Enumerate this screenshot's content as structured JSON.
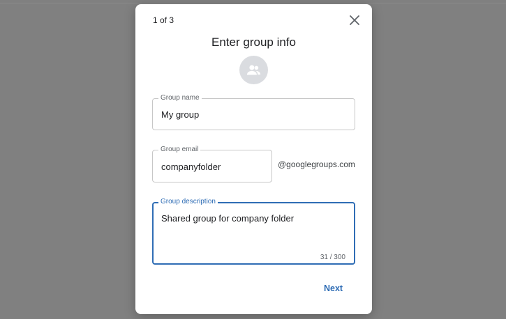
{
  "dialog": {
    "step": "1 of 3",
    "title": "Enter group info",
    "close_icon": "close-icon",
    "avatar_icon": "group-icon",
    "next_label": "Next"
  },
  "form": {
    "group_name": {
      "label": "Group name",
      "value": "My group"
    },
    "group_email": {
      "label": "Group email",
      "value": "companyfolder",
      "suffix": "@googlegroups.com"
    },
    "group_description": {
      "label": "Group description",
      "value": "Shared group for company folder",
      "counter": "31 / 300"
    }
  },
  "colors": {
    "backdrop": "#808080",
    "accent": "#2f6db5",
    "avatar_bg": "#dadce0"
  }
}
